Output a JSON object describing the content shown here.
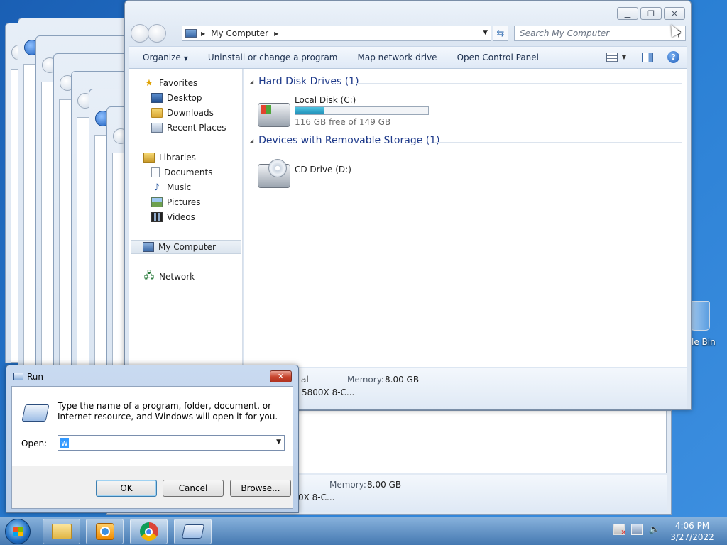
{
  "desktop": {
    "recycle_bin_label": "le Bin"
  },
  "explorer": {
    "address": {
      "crumb": "My Computer"
    },
    "search_placeholder": "Search My Computer",
    "toolbar": {
      "organize": "Organize",
      "uninstall": "Uninstall or change a program",
      "map_drive": "Map network drive",
      "control_panel": "Open Control Panel",
      "help": "?"
    },
    "nav": {
      "favorites": "Favorites",
      "desktop": "Desktop",
      "downloads": "Downloads",
      "recent_places": "Recent Places",
      "libraries": "Libraries",
      "documents": "Documents",
      "music": "Music",
      "pictures": "Pictures",
      "videos": "Videos",
      "my_computer": "My Computer",
      "network": "Network"
    },
    "groups": {
      "hard_disks": "Hard Disk Drives (1)",
      "removable": "Devices with Removable Storage (1)"
    },
    "drives": {
      "c_name": "Local Disk (C:)",
      "c_free": "116 GB free of 149 GB",
      "c_used_fraction": 0.22,
      "d_name": "CD Drive (D:)"
    },
    "details": {
      "partial_left": "al",
      "memory_label": "Memory:",
      "memory_value": "8.00 GB",
      "processor": "5800X 8-C..."
    }
  },
  "back_window": {
    "details": {
      "memory_label": "Memory:",
      "memory_value": "8.00 GB",
      "processor": "0X 8-C..."
    }
  },
  "run_dialog": {
    "title": "Run",
    "close": "✕",
    "description": "Type the name of a program, folder, document, or Internet resource, and Windows will open it for you.",
    "open_label": "Open:",
    "open_value": "w",
    "ok": "OK",
    "cancel": "Cancel",
    "browse": "Browse..."
  },
  "taskbar": {
    "time": "4:06 PM",
    "date": "3/27/2022"
  }
}
